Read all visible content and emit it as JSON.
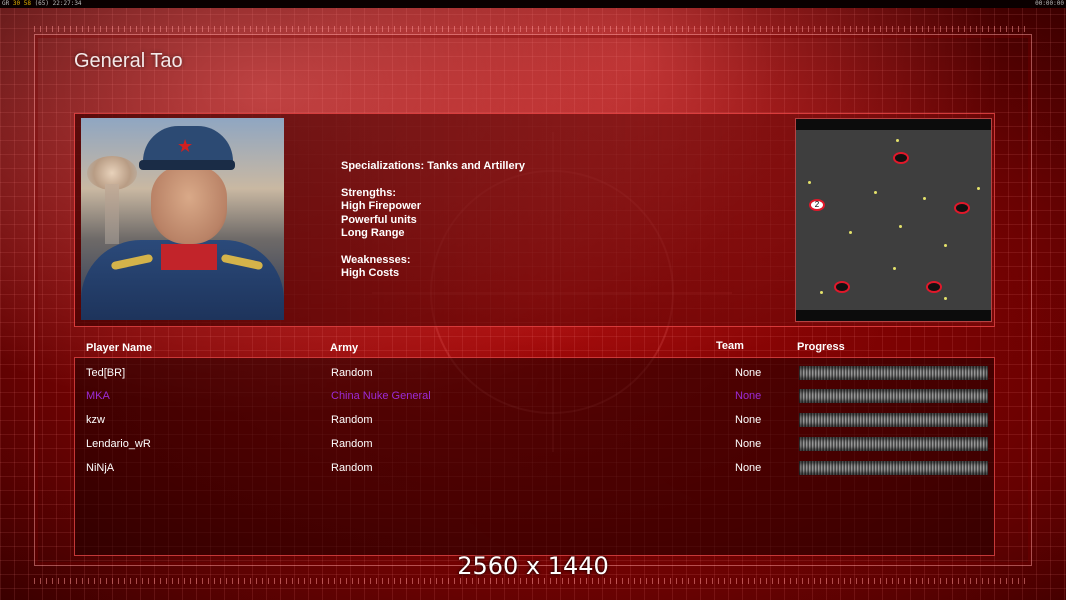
{
  "topbar": {
    "left_prefix": "GR ",
    "left_a": "30",
    "left_b": "58",
    "left_c": "(65)",
    "time": "22:27:34",
    "right": "00:00:00"
  },
  "general": {
    "name": "General Tao",
    "specializations": "Specializations: Tanks and Artillery",
    "strengths_heading": "Strengths:",
    "strengths": [
      "High Firepower",
      "Powerful units",
      "Long Range"
    ],
    "weaknesses_heading": "Weaknesses:",
    "weaknesses": [
      "High Costs"
    ]
  },
  "minimap": {
    "start_marker_label": "2"
  },
  "table": {
    "headers": {
      "player": "Player Name",
      "army": "Army",
      "team": "Team",
      "progress": "Progress"
    },
    "rows": [
      {
        "player": "Ted[BR]",
        "army": "Random",
        "team": "None",
        "color": "#ffffff"
      },
      {
        "player": "MKA",
        "army": "China Nuke General",
        "team": "None",
        "color": "#9b2bd6"
      },
      {
        "player": "kzw",
        "army": "Random",
        "team": "None",
        "color": "#ffffff"
      },
      {
        "player": "Lendario_wR",
        "army": "Random",
        "team": "None",
        "color": "#ffffff"
      },
      {
        "player": "NiNjA",
        "army": "Random",
        "team": "None",
        "color": "#ffffff"
      }
    ]
  },
  "overlay": {
    "resolution": "2560 x 1440"
  },
  "colors": {
    "accent": "#e0182a",
    "highlight_player": "#9b2bd6"
  }
}
